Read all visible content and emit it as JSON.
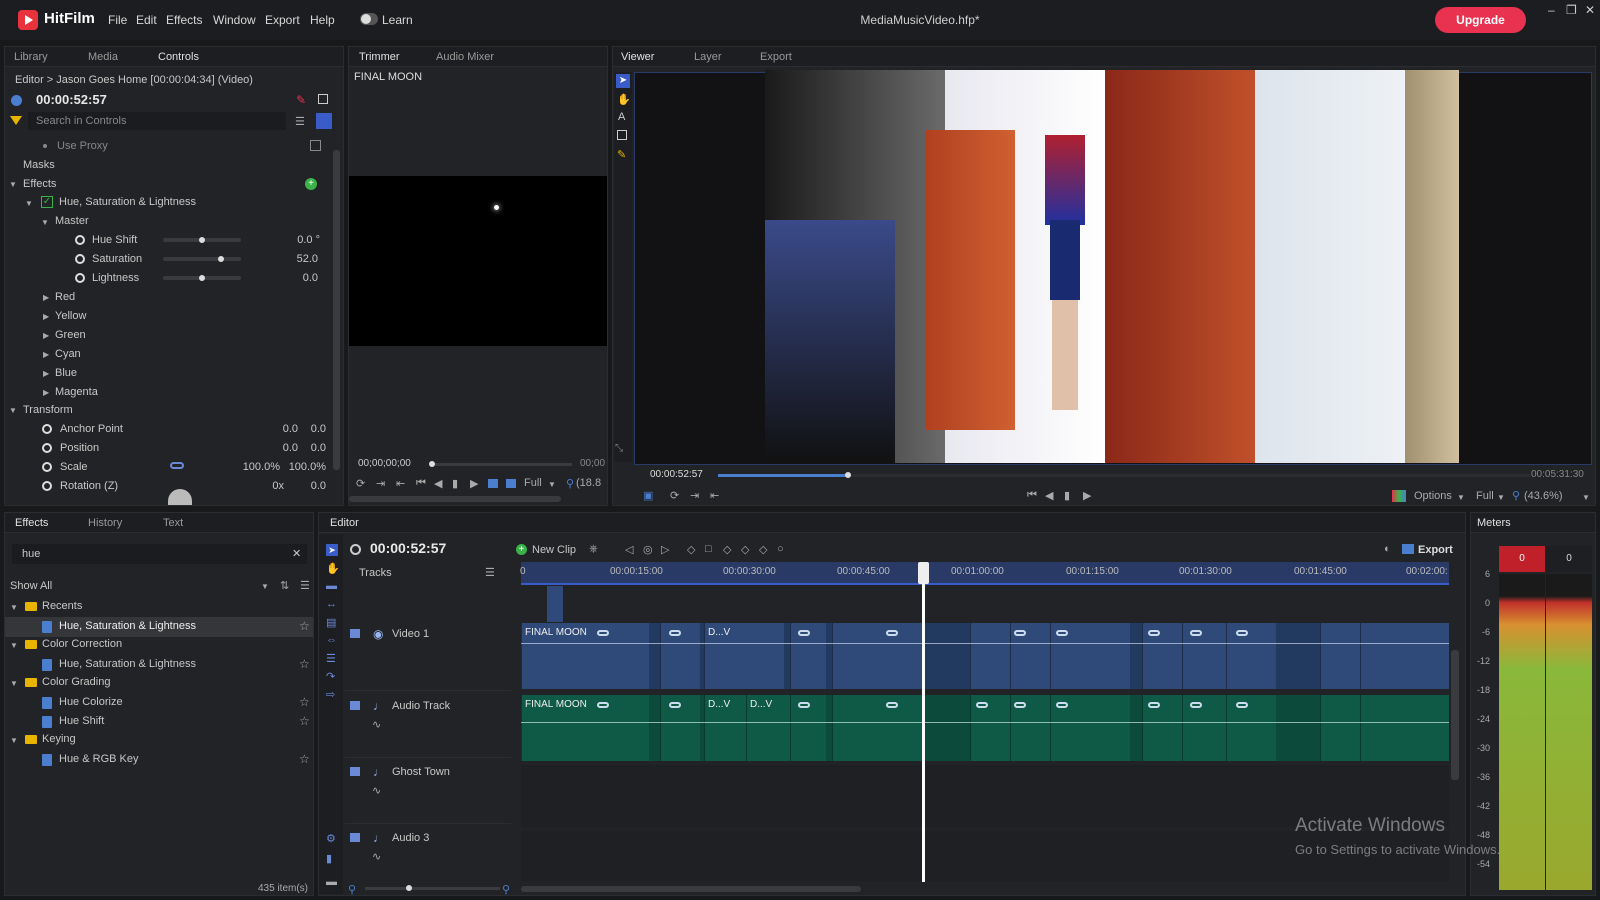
{
  "app": {
    "name": "HitFilm",
    "file_title": "MediaMusicVideo.hfp*",
    "upgrade_label": "Upgrade",
    "learn_label": "Learn"
  },
  "menu": [
    "File",
    "Edit",
    "Effects",
    "Window",
    "Export",
    "Help"
  ],
  "controls_panel": {
    "tabs": [
      "Library",
      "Media",
      "Controls"
    ],
    "breadcrumb": "Editor > Jason Goes Home [00:00:04:34] (Video)",
    "timecode": "00:00:52:57",
    "search_placeholder": "Search in Controls",
    "use_proxy": "Use Proxy",
    "masks": "Masks",
    "effects": "Effects",
    "effect_name": "Hue, Saturation & Lightness",
    "master": "Master",
    "params": [
      {
        "label": "Hue Shift",
        "value": "0.0 °",
        "level": 0.5
      },
      {
        "label": "Saturation",
        "value": "52.0",
        "level": 0.74
      },
      {
        "label": "Lightness",
        "value": "0.0",
        "level": 0.5
      }
    ],
    "color_groups": [
      "Red",
      "Yellow",
      "Green",
      "Cyan",
      "Blue",
      "Magenta"
    ],
    "transform": "Transform",
    "transform_params": [
      {
        "label": "Anchor Point",
        "v1": "0.0",
        "v2": "0.0"
      },
      {
        "label": "Position",
        "v1": "0.0",
        "v2": "0.0"
      },
      {
        "label": "Scale",
        "v1": "100.0%",
        "v2": "100.0%"
      },
      {
        "label": "Rotation (Z)",
        "v1": "0x",
        "v2": "0.0"
      }
    ]
  },
  "trimmer_panel": {
    "tabs": [
      "Trimmer",
      "Audio Mixer"
    ],
    "clip_name": "FINAL MOON",
    "timecode": "00;00;00;00",
    "end_timecode": "00;00",
    "quality": "Full",
    "zoom": "(18.8"
  },
  "viewer_panel": {
    "tabs": [
      "Viewer",
      "Layer",
      "Export"
    ],
    "timecode": "00:00:52:57",
    "duration": "00:05:31:30",
    "options_label": "Options",
    "quality": "Full",
    "zoom": "(43.6%)",
    "playhead_fraction": 0.16
  },
  "effects_panel": {
    "tabs": [
      "Effects",
      "History",
      "Text"
    ],
    "search_value": "hue",
    "filter": "Show All",
    "groups": [
      {
        "name": "Recents",
        "items": [
          "Hue, Saturation & Lightness"
        ]
      },
      {
        "name": "Color Correction",
        "items": [
          "Hue, Saturation & Lightness"
        ]
      },
      {
        "name": "Color Grading",
        "items": [
          "Hue Colorize",
          "Hue Shift"
        ]
      },
      {
        "name": "Keying",
        "items": [
          "Hue & RGB Key"
        ]
      }
    ],
    "count": "435 item(s)"
  },
  "editor_panel": {
    "tab": "Editor",
    "timecode": "00:00:52:57",
    "new_clip": "New Clip",
    "export": "Export",
    "tracks_label": "Tracks",
    "ruler_labels": [
      "0",
      "00:00:15:00",
      "00:00:30:00",
      "00:00:45:00",
      "00:01:00:00",
      "00:01:15:00",
      "00:01:30:00",
      "00:01:45:00",
      "00:02:00:"
    ],
    "tracks": [
      "Video 1",
      "Audio Track",
      "Ghost Town",
      "Audio 3"
    ],
    "video_clip_labels": [
      "FINAL MOON",
      "D...V"
    ],
    "audio_clip_labels": [
      "FINAL MOON",
      "D...V",
      "D...V"
    ]
  },
  "meters_panel": {
    "tab": "Meters",
    "left_peak": "0",
    "right_peak": "0",
    "scale": [
      "6",
      "0",
      "-6",
      "-12",
      "-18",
      "-24",
      "-30",
      "-36",
      "-42",
      "-48",
      "-54"
    ]
  },
  "watermark": {
    "line1": "Activate Windows",
    "line2": "Go to Settings to activate Windows."
  },
  "colors": {
    "accent": "#e8324f",
    "video_track": "#2f4a78",
    "audio_track": "#0e5a47",
    "ruler": "#2a3a66"
  }
}
